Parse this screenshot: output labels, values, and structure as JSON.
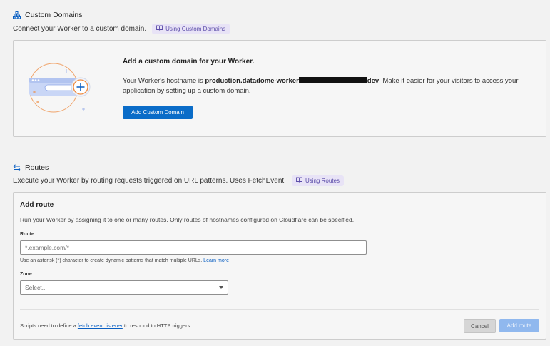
{
  "custom_domains": {
    "title": "Custom Domains",
    "description": "Connect your Worker to a custom domain.",
    "doc_link": "Using Custom Domains",
    "card": {
      "heading": "Add a custom domain for your Worker.",
      "body_prefix": "Your Worker's hostname is ",
      "hostname_start": "production.datadome-worker",
      "hostname_end": "dev",
      "body_suffix": ". Make it easier for your visitors to access your application by setting up a custom domain.",
      "button": "Add Custom Domain"
    }
  },
  "routes": {
    "title": "Routes",
    "description": "Execute your Worker by routing requests triggered on URL patterns. Uses FetchEvent.",
    "doc_link": "Using Routes",
    "card": {
      "heading": "Add route",
      "description": "Run your Worker by assigning it to one or many routes. Only routes of hostnames configured on Cloudflare can be specified.",
      "route_label": "Route",
      "route_placeholder": "*.example.com/*",
      "route_hint": "Use an asterisk (*) character to create dynamic patterns that match multiple URLs.",
      "route_hint_link": "Learn more",
      "zone_label": "Zone",
      "zone_placeholder": "Select...",
      "footer_prefix": "Scripts need to define a ",
      "footer_link": "fetch event listener",
      "footer_suffix": " to respond to HTTP triggers.",
      "cancel": "Cancel",
      "add": "Add route"
    }
  },
  "icons": [
    "sitemap-icon",
    "book-icon",
    "arrows-swap-icon",
    "custom-domain-illustration",
    "chevron-down-icon"
  ],
  "colors": {
    "primary_button": "#0a6cc8",
    "disabled_button": "#90b8ee",
    "doc_pill_bg": "#e8e3f6",
    "doc_pill_text": "#5a4ba8",
    "illustration_orange": "#f08a3c"
  }
}
